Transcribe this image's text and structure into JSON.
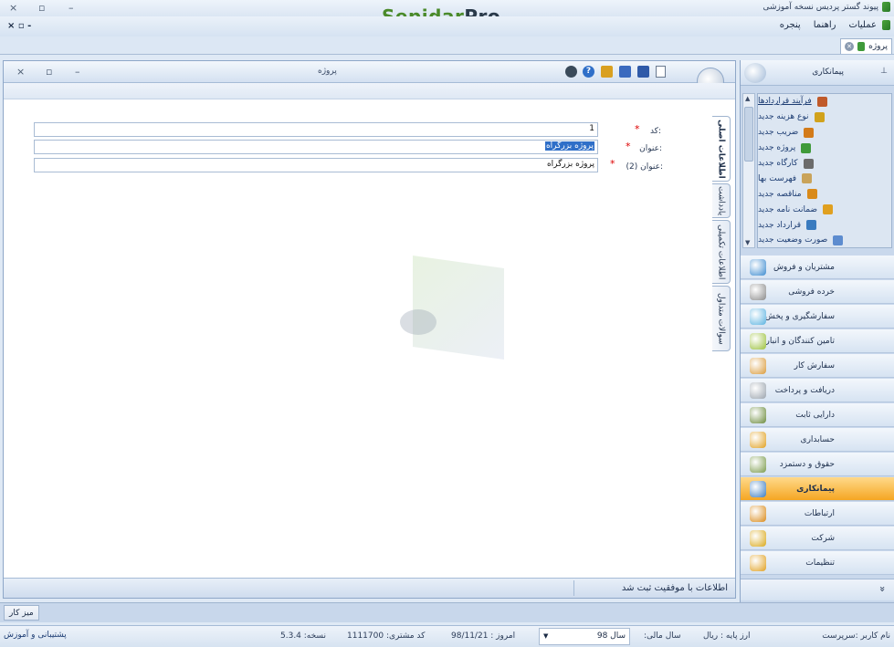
{
  "window": {
    "title": "پیوند گستر پردیس نسخه آموزشی",
    "brand_part1": "Sepidar",
    "brand_part2": "Pro",
    "min": "–",
    "restore": "▫",
    "close": "×"
  },
  "menu": {
    "items": [
      "عملیات",
      "راهنما",
      "پنجره"
    ],
    "mdi_controls": "× ▫ -"
  },
  "tabs": {
    "active_tab": "پروژه"
  },
  "form": {
    "title": "پروژه",
    "vertical_tabs": [
      "اطلاعات اصلی",
      "یادداشت",
      "اطلاعات تکمیلی",
      "سوالات متداول"
    ],
    "fields": [
      {
        "label": "کد:",
        "required": true,
        "value": "1"
      },
      {
        "label": "عنوان:",
        "required": true,
        "value": "پروژه بزرگراه",
        "selected": true
      },
      {
        "label": "عنوان (2):",
        "required": true,
        "value": "پروژه بزرگراه"
      }
    ],
    "status_message": "اطلاعات با موفقیت ثبت شد"
  },
  "right_panel": {
    "header": "پیمانکاری",
    "pin": "ꟷ",
    "links": [
      {
        "label": "فرآیند قراردادها",
        "icon": "flow-icon",
        "color": "#c05a2a",
        "underline": true
      },
      {
        "label": "نوع هزینه جدید",
        "icon": "cost-type-icon",
        "color": "#d1a21c"
      },
      {
        "label": "ضریب جدید",
        "icon": "percent-icon",
        "color": "#d37b1a"
      },
      {
        "label": "پروژه جدید",
        "icon": "project-icon",
        "color": "#3f9a3a"
      },
      {
        "label": "کارگاه جدید",
        "icon": "workshop-icon",
        "color": "#6b6b6b"
      },
      {
        "label": "فهرست بها",
        "icon": "price-list-icon",
        "color": "#c9a35a"
      },
      {
        "label": "مناقصه جدید",
        "icon": "tender-icon",
        "color": "#d98a1a"
      },
      {
        "label": "ضمانت نامه جدید",
        "icon": "guarantee-icon",
        "color": "#e0a020"
      },
      {
        "label": "قرارداد جدید",
        "icon": "contract-icon",
        "color": "#3a7bbf"
      },
      {
        "label": "صورت وضعیت جدید",
        "icon": "statement-icon",
        "color": "#5d8ccf"
      }
    ],
    "nav": [
      {
        "label": "مشتریان و فروش",
        "icon": "customers-icon",
        "color": "#3c8bd0"
      },
      {
        "label": "خرده فروشی",
        "icon": "retail-icon",
        "color": "#8a8a8a"
      },
      {
        "label": "سفارشگیری و پخش",
        "icon": "distribution-icon",
        "color": "#5ab2e0"
      },
      {
        "label": "تامین کنندگان و انبار",
        "icon": "suppliers-icon",
        "color": "#9ac03a"
      },
      {
        "label": "سفارش کار",
        "icon": "work-order-icon",
        "color": "#d99a3a"
      },
      {
        "label": "دریافت و پرداخت",
        "icon": "payment-icon",
        "color": "#9aa3ad"
      },
      {
        "label": "دارایی ثابت",
        "icon": "assets-icon",
        "color": "#6a8a3a"
      },
      {
        "label": "حسابداری",
        "icon": "accounting-icon",
        "color": "#e0a020"
      },
      {
        "label": "حقوق و دستمزد",
        "icon": "payroll-icon",
        "color": "#7a9a4a"
      },
      {
        "label": "پیمانکاری",
        "icon": "contracting-icon",
        "color": "#3a7bbf",
        "active": true
      },
      {
        "label": "ارتباطات",
        "icon": "communications-icon",
        "color": "#d98a1a"
      },
      {
        "label": "شرکت",
        "icon": "company-icon",
        "color": "#d9a81a"
      },
      {
        "label": "تنظیمات",
        "icon": "settings-icon",
        "color": "#e0a020"
      }
    ],
    "more": "»"
  },
  "taskbar": {
    "desk_button": "میز کار"
  },
  "bottom": {
    "user": "نام کاربر :سرپرست",
    "base_currency": "ارز پایه : ریال",
    "fiscal_year_label": "سال مالی:",
    "fiscal_year_value": "سال 98",
    "today": "امروز : 98/11/21",
    "customer_code": "کد مشتری: 1111700",
    "version": "نسخه: 5.3.4",
    "support": "پشتیبانی و آموزش"
  },
  "colors": {
    "accent": "#2f6fc8",
    "active_nav": "#f5a623",
    "required": "#dd0000"
  }
}
